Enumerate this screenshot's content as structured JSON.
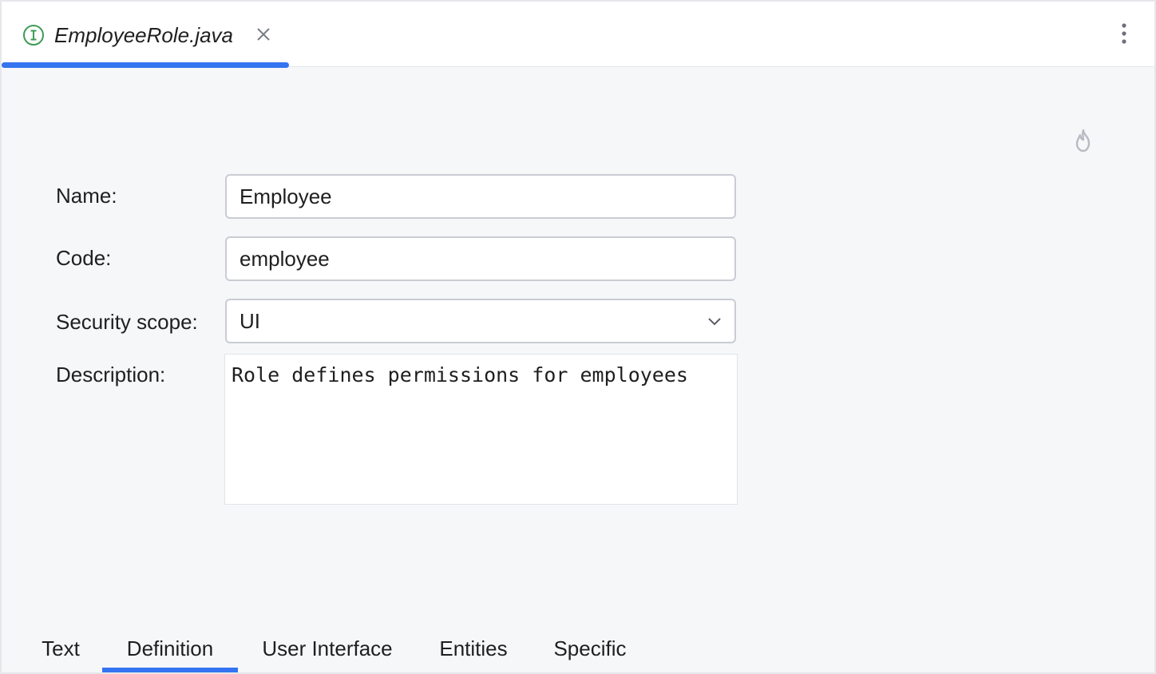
{
  "editor": {
    "tab": {
      "title": "EmployeeRole.java",
      "icon": "interface-icon",
      "close_icon": "close-icon"
    },
    "menu_icon": "more-vertical-icon",
    "accent_color": "#3574f0"
  },
  "toolbar": {
    "hotswap_icon": "flame-icon"
  },
  "form": {
    "name": {
      "label": "Name:",
      "value": "Employee"
    },
    "code": {
      "label": "Code:",
      "value": "employee"
    },
    "security_scope": {
      "label": "Security scope:",
      "value": "UI"
    },
    "description": {
      "label": "Description:",
      "value": "Role defines permissions for employees"
    }
  },
  "bottom_tabs": {
    "active": "Definition",
    "items": [
      "Text",
      "Definition",
      "User Interface",
      "Entities",
      "Specific"
    ]
  }
}
